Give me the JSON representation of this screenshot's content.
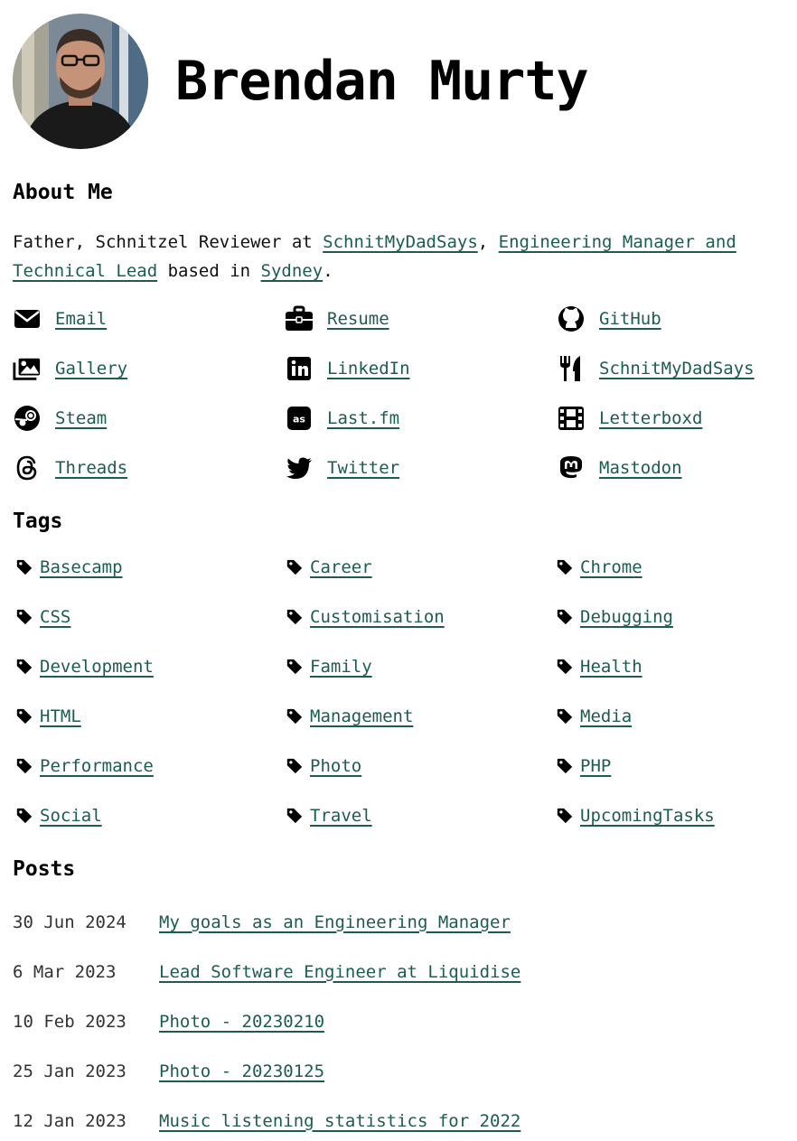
{
  "site": {
    "title": "Brendan Murty"
  },
  "about": {
    "heading": "About Me",
    "text_1": "Father, Schnitzel Reviewer at ",
    "link_1": "SchnitMyDadSays",
    "text_2": ", ",
    "link_2": "Engineering Manager and Technical Lead",
    "text_3": " based in ",
    "link_3": "Sydney",
    "text_4": "."
  },
  "links": [
    {
      "label": "Email",
      "icon": "envelope-icon"
    },
    {
      "label": "Resume",
      "icon": "briefcase-icon"
    },
    {
      "label": "GitHub",
      "icon": "github-icon"
    },
    {
      "label": "Gallery",
      "icon": "images-icon"
    },
    {
      "label": "LinkedIn",
      "icon": "linkedin-icon"
    },
    {
      "label": "SchnitMyDadSays",
      "icon": "utensils-icon"
    },
    {
      "label": "Steam",
      "icon": "steam-icon"
    },
    {
      "label": "Last.fm",
      "icon": "lastfm-icon"
    },
    {
      "label": "Letterboxd",
      "icon": "film-icon"
    },
    {
      "label": "Threads",
      "icon": "threads-icon"
    },
    {
      "label": "Twitter",
      "icon": "twitter-icon"
    },
    {
      "label": "Mastodon",
      "icon": "mastodon-icon"
    }
  ],
  "tags": {
    "heading": "Tags",
    "items": [
      "Basecamp",
      "Career",
      "Chrome",
      "CSS",
      "Customisation",
      "Debugging",
      "Development",
      "Family",
      "Health",
      "HTML",
      "Management",
      "Media",
      "Performance",
      "Photo",
      "PHP",
      "Social",
      "Travel",
      "UpcomingTasks"
    ]
  },
  "posts": {
    "heading": "Posts",
    "items": [
      {
        "date": "30 Jun 2024",
        "title": "My goals as an Engineering Manager"
      },
      {
        "date": "6 Mar 2023",
        "title": "Lead Software Engineer at Liquidise"
      },
      {
        "date": "10 Feb 2023",
        "title": "Photo - 20230210"
      },
      {
        "date": "25 Jan 2023",
        "title": "Photo - 20230125"
      },
      {
        "date": "12 Jan 2023",
        "title": "Music listening statistics for 2022"
      }
    ]
  },
  "colors": {
    "link": "#1d5c4e",
    "text": "#111111"
  }
}
